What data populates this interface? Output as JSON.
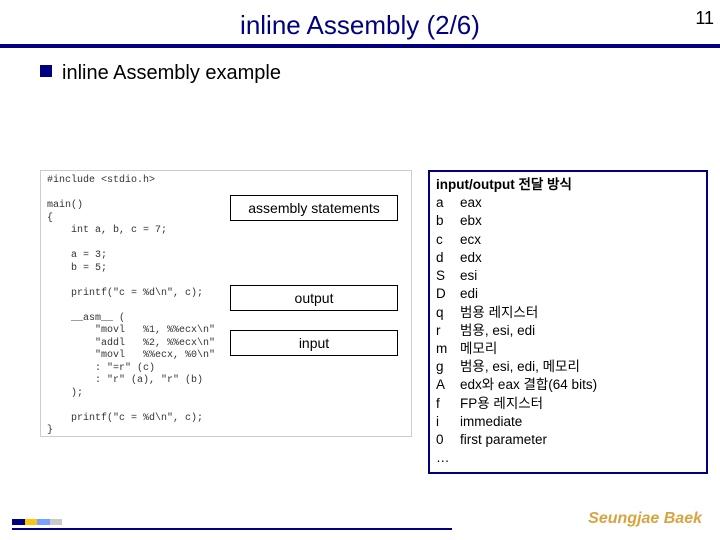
{
  "page_number": "11",
  "title": "inline Assembly (2/6)",
  "subtitle": "inline Assembly example",
  "code_text": "#include <stdio.h>\n\nmain()\n{\n    int a, b, c = 7;\n\n    a = 3;\n    b = 5;\n\n    printf(\"c = %d\\n\", c);\n\n    __asm__ (\n        \"movl   %1, %%ecx\\n\"\n        \"addl   %2, %%ecx\\n\"\n        \"movl   %%ecx, %0\\n\"\n        : \"=r\" (c)\n        : \"r\" (a), \"r\" (b)\n    );\n\n    printf(\"c = %d\\n\", c);\n}",
  "labels": {
    "l1": "assembly statements",
    "l2": "output",
    "l3": "input"
  },
  "table": {
    "header": "input/output 전달 방식",
    "rows": [
      {
        "k": "a",
        "v": "eax"
      },
      {
        "k": "b",
        "v": "ebx"
      },
      {
        "k": "c",
        "v": "ecx"
      },
      {
        "k": "d",
        "v": "edx"
      },
      {
        "k": "S",
        "v": "esi"
      },
      {
        "k": "D",
        "v": "edi"
      },
      {
        "k": "q",
        "v": "범용 레지스터"
      },
      {
        "k": "r",
        "v": "범용, esi, edi"
      },
      {
        "k": "m",
        "v": "메모리"
      },
      {
        "k": "g",
        "v": "범용, esi, edi, 메모리"
      },
      {
        "k": "A",
        "v": "edx와 eax 결합(64 bits)"
      },
      {
        "k": "f",
        "v": "FP용 레지스터"
      },
      {
        "k": "i",
        "v": "immediate"
      },
      {
        "k": "0",
        "v": "first parameter"
      },
      {
        "k": "…",
        "v": ""
      }
    ]
  },
  "footer_brand": "Seungjae Baek"
}
